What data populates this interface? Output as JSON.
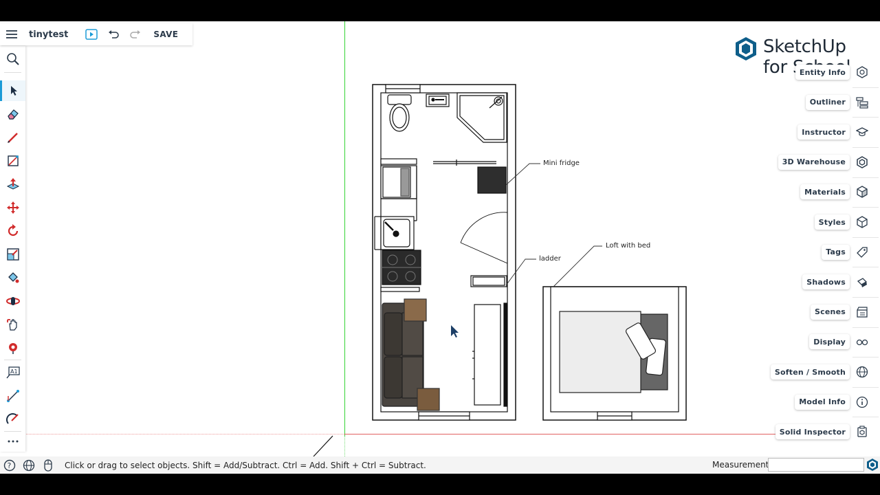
{
  "file": {
    "title": "tinytest",
    "save_label": "SAVE"
  },
  "brand": {
    "line1": "SketchUp",
    "line2": "for Schools"
  },
  "left_tools": [
    "search-icon",
    "select-icon",
    "eraser-icon",
    "pencil-icon",
    "rectangle-icon",
    "push-pull-icon",
    "move-icon",
    "rotate-icon",
    "scale-icon",
    "paint-bucket-icon",
    "orbit-icon",
    "pan-icon",
    "position-camera-icon",
    "text-icon",
    "dimension-icon",
    "tape-measure-icon",
    "more-icon"
  ],
  "right_panel": {
    "items": [
      {
        "label": "Entity Info",
        "icon": "entity-info-icon"
      },
      {
        "label": "Outliner",
        "icon": "outliner-icon"
      },
      {
        "label": "Instructor",
        "icon": "instructor-icon"
      },
      {
        "label": "3D Warehouse",
        "icon": "warehouse-icon"
      },
      {
        "label": "Materials",
        "icon": "materials-icon"
      },
      {
        "label": "Styles",
        "icon": "styles-icon"
      },
      {
        "label": "Tags",
        "icon": "tags-icon"
      },
      {
        "label": "Shadows",
        "icon": "shadows-icon"
      },
      {
        "label": "Scenes",
        "icon": "scenes-icon"
      },
      {
        "label": "Display",
        "icon": "display-icon"
      },
      {
        "label": "Soften / Smooth",
        "icon": "soften-icon"
      },
      {
        "label": "Model Info",
        "icon": "model-info-icon"
      },
      {
        "label": "Solid Inspector",
        "icon": "solid-inspector-icon"
      }
    ]
  },
  "drawing": {
    "labels": {
      "mini_fridge": "Mini fridge",
      "ladder": "ladder",
      "loft": "Loft with bed"
    }
  },
  "status": {
    "message": "Click or drag to select objects. Shift = Add/Subtract. Ctrl = Add. Shift + Ctrl = Subtract.",
    "measurements_label": "Measurements",
    "measurements_value": ""
  },
  "colors": {
    "accent": "#1b9bd7",
    "axis_green": "#35d335",
    "axis_red": "#e06060",
    "tool_red": "#d12b2b"
  }
}
